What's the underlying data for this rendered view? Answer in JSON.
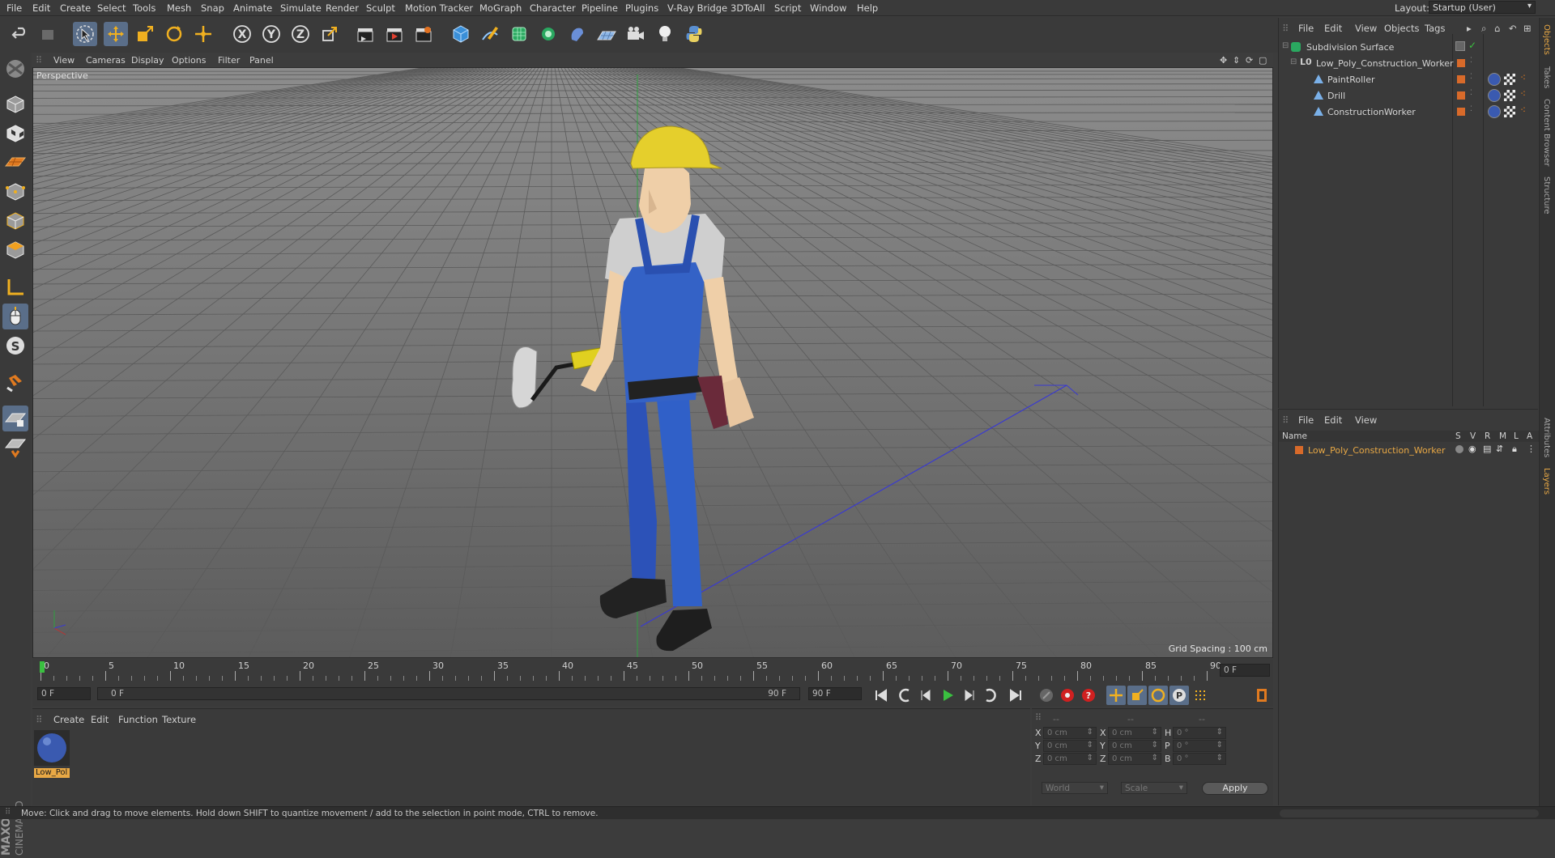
{
  "menu": [
    "File",
    "Edit",
    "Create",
    "Select",
    "Tools",
    "Mesh",
    "Snap",
    "Animate",
    "Simulate",
    "Render",
    "Sculpt",
    "Motion Tracker",
    "MoGraph",
    "Character",
    "Pipeline",
    "Plugins",
    "V-Ray Bridge",
    "3DToAll",
    "Script",
    "Window",
    "Help"
  ],
  "layout": {
    "label": "Layout:",
    "value": "Startup (User)"
  },
  "toolbar": {
    "x": "X",
    "y": "Y",
    "z": "Z"
  },
  "viewport": {
    "menu": [
      "View",
      "Cameras",
      "Display",
      "Options",
      "Filter",
      "Panel"
    ],
    "label": "Perspective",
    "grid_spacing": "Grid Spacing : 100 cm"
  },
  "timeline": {
    "ticks": [
      "0",
      "5",
      "10",
      "15",
      "20",
      "25",
      "30",
      "35",
      "40",
      "45",
      "50",
      "55",
      "60",
      "65",
      "70",
      "75",
      "80",
      "85",
      "90"
    ],
    "current_frame": "0 F"
  },
  "transport": {
    "start_field": "0 F",
    "range_start": "0 F",
    "range_end": "90 F",
    "end_field": "90 F"
  },
  "material_manager": {
    "menu": [
      "Create",
      "Edit",
      "Function",
      "Texture"
    ],
    "materials": [
      {
        "name": "Low_Pol"
      }
    ]
  },
  "coordinates": {
    "header": [
      "--",
      "--",
      "--"
    ],
    "rows": [
      {
        "a": "X",
        "av": "0 cm",
        "b": "X",
        "bv": "0 cm",
        "c": "H",
        "cv": "0 °"
      },
      {
        "a": "Y",
        "av": "0 cm",
        "b": "Y",
        "bv": "0 cm",
        "c": "P",
        "cv": "0 °"
      },
      {
        "a": "Z",
        "av": "0 cm",
        "b": "Z",
        "bv": "0 cm",
        "c": "B",
        "cv": "0 °"
      }
    ],
    "world": "World",
    "scale": "Scale",
    "apply": "Apply"
  },
  "object_manager": {
    "menu": [
      "File",
      "Edit",
      "View",
      "Objects",
      "Tags"
    ],
    "objects": [
      {
        "name": "Subdivision Surface"
      },
      {
        "name": "Low_Poly_Construction_Worker"
      },
      {
        "name": "PaintRoller"
      },
      {
        "name": "Drill"
      },
      {
        "name": "ConstructionWorker"
      }
    ]
  },
  "layer_manager": {
    "menu": [
      "File",
      "Edit",
      "View"
    ],
    "columns": {
      "name": "Name",
      "s": "S",
      "v": "V",
      "r": "R",
      "m": "M",
      "l": "L",
      "a": "A"
    },
    "layers": [
      {
        "name": "Low_Poly_Construction_Worker"
      }
    ]
  },
  "side_tabs": [
    "Objects",
    "Takes",
    "Content Browser",
    "Structure",
    "Attributes",
    "Layers"
  ],
  "status": "Move: Click and drag to move elements. Hold down SHIFT to quantize movement / add to the selection in point mode, CTRL to remove.",
  "brand": {
    "maxon": "MAXON",
    "cinema": "CINEMA 4D"
  },
  "colors": {
    "accent": "#e8a845",
    "layer_orange": "#d86a2a",
    "highlight": "#5a6e89"
  }
}
